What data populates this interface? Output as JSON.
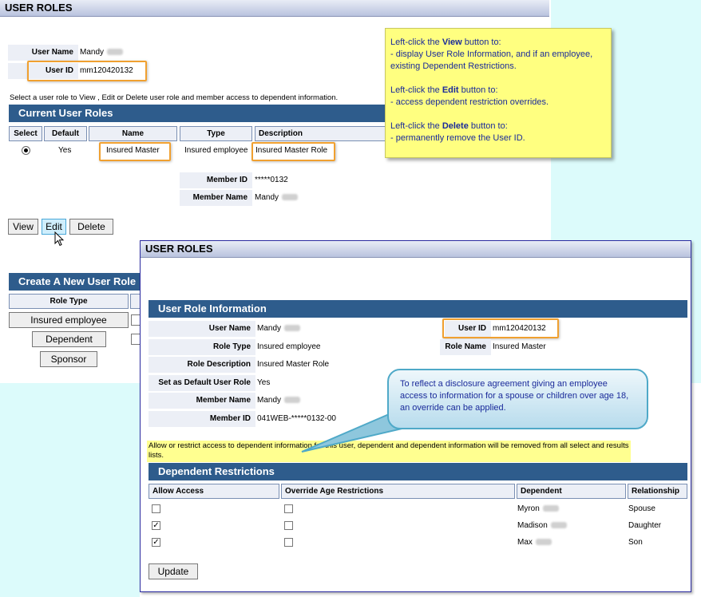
{
  "page1": {
    "title": "USER ROLES",
    "user_name_label": "User Name",
    "user_name_value": "Mandy",
    "user_id_label": "User ID",
    "user_id_value": "mm120420132",
    "instruction": "Select a user role to View , Edit or Delete user role and member access to dependent information.",
    "current_roles_header": "Current User Roles",
    "columns": [
      "Select",
      "Default",
      "Name",
      "Type",
      "Description"
    ],
    "row": {
      "default": "Yes",
      "name": "Insured Master",
      "type": "Insured employee",
      "description": "Insured Master Role"
    },
    "member_id_label": "Member ID",
    "member_id_value": "*****0132",
    "member_name_label": "Member Name",
    "member_name_value": "Mandy",
    "buttons": {
      "view": "View",
      "edit": "Edit",
      "delete": "Delete"
    },
    "create_header": "Create A New User Role",
    "role_type_header": "Role Type",
    "role_buttons": [
      "Insured employee",
      "Dependent",
      "Sponsor"
    ]
  },
  "note_view": {
    "line1_pre": "Left-click the ",
    "line1_bold": "View",
    "line1_post": " button to:",
    "line2": " - display User Role Information, and if an employee, existing Dependent Restrictions.",
    "line3_pre": "Left-click the ",
    "line3_bold": "Edit",
    "line3_post": " button to:",
    "line4": "- access dependent restriction overrides.",
    "line5_pre": "Left-click the ",
    "line5_bold": "Delete",
    "line5_post": " button to:",
    "line6": "- permanently remove the User ID."
  },
  "page2": {
    "title": "USER ROLES",
    "info_header": "User Role Information",
    "fields": {
      "user_name_label": "User Name",
      "user_name_value": "Mandy",
      "role_type_label": "Role Type",
      "role_type_value": "Insured employee",
      "role_desc_label": "Role Description",
      "role_desc_value": "Insured Master Role",
      "default_label": "Set as Default User Role",
      "default_value": "Yes",
      "member_name_label": "Member Name",
      "member_name_value": "Mandy",
      "member_id_label": "Member ID",
      "member_id_value": "041WEB-*****0132-00",
      "user_id_label": "User ID",
      "user_id_value": "mm120420132",
      "role_name_label": "Role Name",
      "role_name_value": "Insured Master"
    },
    "allow_text": "Allow or restrict access to dependent information for this user, dependent and dependent information will be removed from all select and results lists.",
    "restrictions_header": "Dependent Restrictions",
    "columns": [
      "Allow Access",
      "Override Age Restrictions",
      "Dependent",
      "Relationship"
    ],
    "dependents": [
      {
        "name": "Myron",
        "relationship": "Spouse",
        "allow": false,
        "override": false
      },
      {
        "name": "Madison",
        "relationship": "Daughter",
        "allow": true,
        "override": false
      },
      {
        "name": "Max",
        "relationship": "Son",
        "allow": true,
        "override": false
      }
    ],
    "update_button": "Update"
  },
  "callout": {
    "text": "To reflect a disclosure agreement giving an employee access to information for a spouse or children over age 18, an override can be applied."
  },
  "icons": {
    "cursor": "mouse-pointer-icon",
    "check": "✓"
  },
  "colors": {
    "section": "#2e5c8c",
    "highlight": "#f0a030",
    "note": "#ffff80",
    "cyan": "#dcfbfb"
  }
}
